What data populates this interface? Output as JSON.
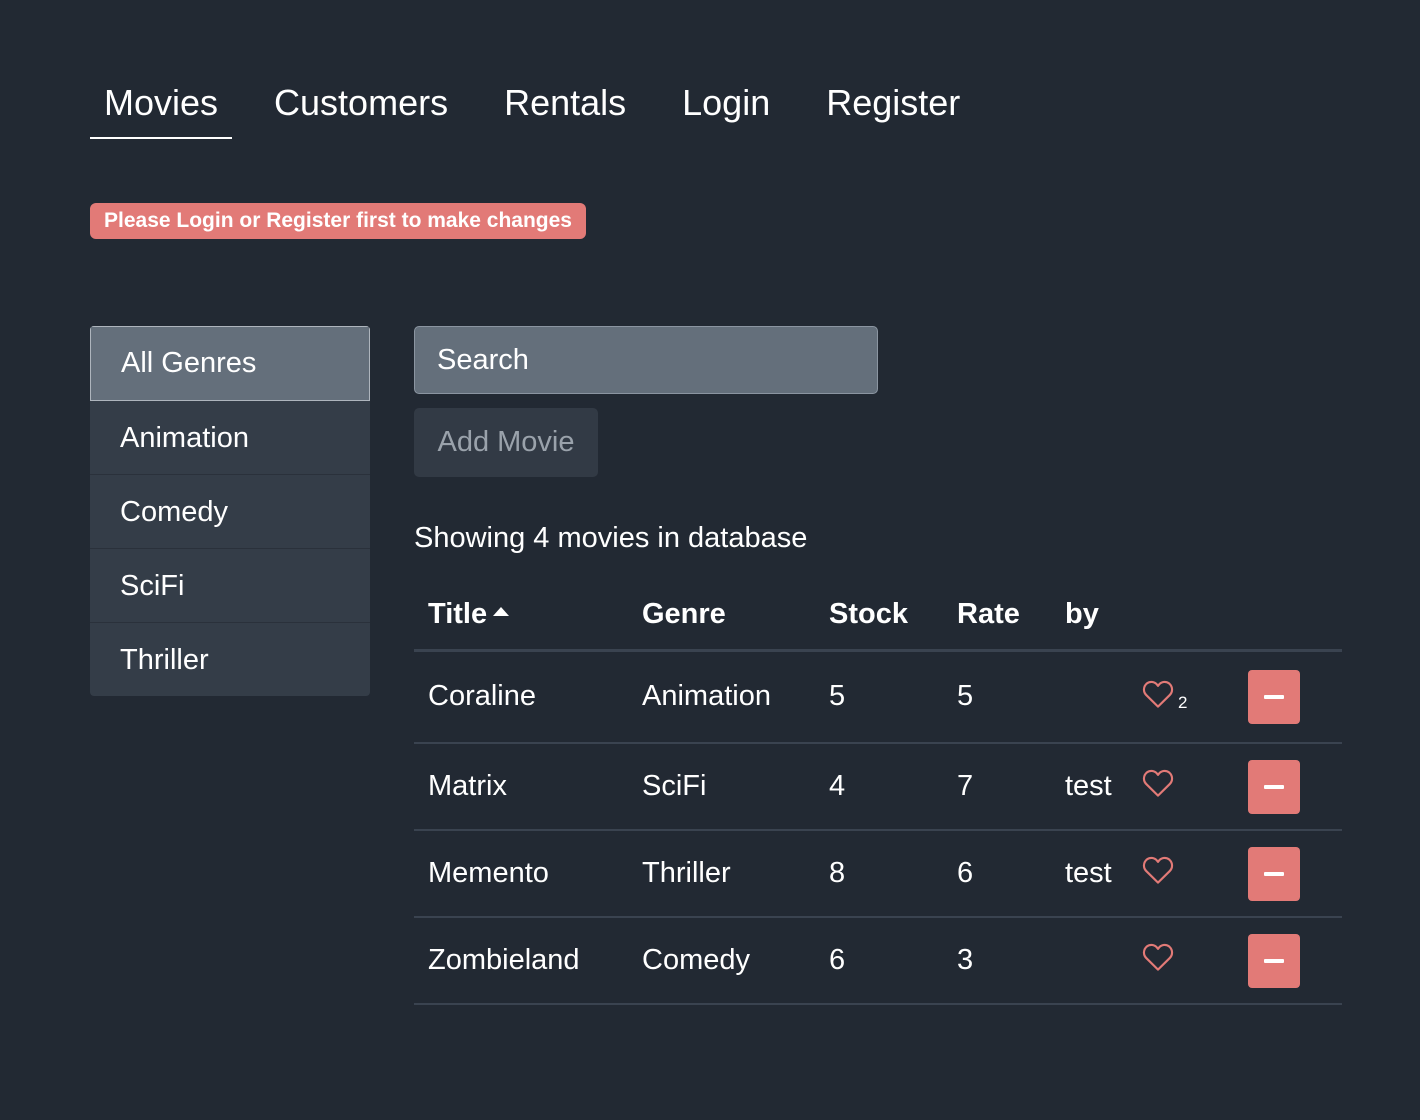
{
  "nav": {
    "items": [
      {
        "label": "Movies"
      },
      {
        "label": "Customers"
      },
      {
        "label": "Rentals"
      },
      {
        "label": "Login"
      },
      {
        "label": "Register"
      }
    ],
    "active": "Movies"
  },
  "alert": {
    "text": "Please Login or Register first to make changes",
    "color": "#e27a77"
  },
  "genres": {
    "items": [
      {
        "label": "All Genres"
      },
      {
        "label": "Animation"
      },
      {
        "label": "Comedy"
      },
      {
        "label": "SciFi"
      },
      {
        "label": "Thriller"
      }
    ],
    "selected": "All Genres"
  },
  "search": {
    "placeholder": "Search"
  },
  "add_movie": {
    "label": "Add Movie"
  },
  "summary": {
    "text": "Showing 4 movies in database"
  },
  "table": {
    "headers": {
      "title": "Title",
      "genre": "Genre",
      "stock": "Stock",
      "rate": "Rate",
      "by": "by"
    },
    "sort": {
      "column": "Title",
      "direction": "asc",
      "icon": "caret-up-icon"
    },
    "rows": [
      {
        "title": "Coraline",
        "genre": "Animation",
        "stock": "5",
        "rate": "5",
        "by": "",
        "likes": "2"
      },
      {
        "title": "Matrix",
        "genre": "SciFi",
        "stock": "4",
        "rate": "7",
        "by": "test",
        "likes": ""
      },
      {
        "title": "Memento",
        "genre": "Thriller",
        "stock": "8",
        "rate": "6",
        "by": "test",
        "likes": ""
      },
      {
        "title": "Zombieland",
        "genre": "Comedy",
        "stock": "6",
        "rate": "3",
        "by": "",
        "likes": ""
      }
    ]
  },
  "icons": {
    "like": "heart-outline-icon",
    "delete": "minus-icon"
  },
  "colors": {
    "background": "#222933",
    "accent": "#e27a77"
  }
}
